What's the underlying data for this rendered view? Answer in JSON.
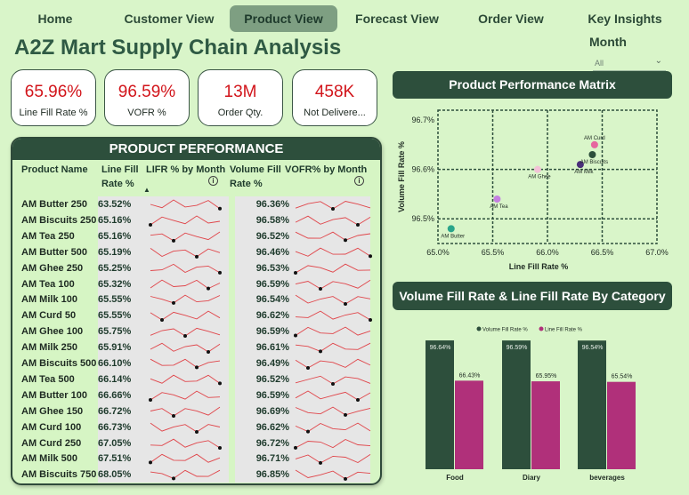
{
  "nav": {
    "tabs": [
      {
        "label": "Home"
      },
      {
        "label": "Customer View"
      },
      {
        "label": "Product View",
        "active": true
      },
      {
        "label": "Forecast View"
      },
      {
        "label": "Order View"
      },
      {
        "label": "Key Insights"
      }
    ]
  },
  "title": "A2Z Mart Supply Chain Analysis",
  "filter": {
    "label": "Month",
    "value": "All"
  },
  "kpis": [
    {
      "value": "65.96%",
      "label": "Line Fill Rate %"
    },
    {
      "value": "96.59%",
      "label": "VOFR %"
    },
    {
      "value": "13M",
      "label": "Order Qty."
    },
    {
      "value": "458K",
      "label": "Not Delivere..."
    }
  ],
  "product_table": {
    "title": "PRODUCT PERFORMANCE",
    "columns": {
      "name": "Product Name",
      "lifr": "Line Fill Rate %",
      "lifr_trend": "LIFR % by Month",
      "vofr": "Volume Fill Rate %",
      "vofr_trend": "VOFR% by Month"
    },
    "rows": [
      {
        "name": "AM Butter 250",
        "lifr": "63.52%",
        "vofr": "96.36%"
      },
      {
        "name": "AM Biscuits 250",
        "lifr": "65.16%",
        "vofr": "96.58%"
      },
      {
        "name": "AM Tea 250",
        "lifr": "65.16%",
        "vofr": "96.52%"
      },
      {
        "name": "AM Butter 500",
        "lifr": "65.19%",
        "vofr": "96.46%"
      },
      {
        "name": "AM Ghee 250",
        "lifr": "65.25%",
        "vofr": "96.53%"
      },
      {
        "name": "AM Tea 100",
        "lifr": "65.32%",
        "vofr": "96.59%"
      },
      {
        "name": "AM Milk 100",
        "lifr": "65.55%",
        "vofr": "96.54%"
      },
      {
        "name": "AM Curd 50",
        "lifr": "65.55%",
        "vofr": "96.62%"
      },
      {
        "name": "AM Ghee 100",
        "lifr": "65.75%",
        "vofr": "96.59%"
      },
      {
        "name": "AM Milk 250",
        "lifr": "65.91%",
        "vofr": "96.61%"
      },
      {
        "name": "AM Biscuits 500",
        "lifr": "66.10%",
        "vofr": "96.49%"
      },
      {
        "name": "AM Tea 500",
        "lifr": "66.14%",
        "vofr": "96.52%"
      },
      {
        "name": "AM Butter 100",
        "lifr": "66.66%",
        "vofr": "96.59%"
      },
      {
        "name": "AM Ghee 150",
        "lifr": "66.72%",
        "vofr": "96.69%"
      },
      {
        "name": "AM Curd 100",
        "lifr": "66.73%",
        "vofr": "96.62%"
      },
      {
        "name": "AM Curd 250",
        "lifr": "67.05%",
        "vofr": "96.72%"
      },
      {
        "name": "AM Milk 500",
        "lifr": "67.51%",
        "vofr": "96.71%"
      },
      {
        "name": "AM Biscuits 750",
        "lifr": "68.05%",
        "vofr": "96.85%"
      }
    ]
  },
  "colors": {
    "accent_dark": "#2d4f3c",
    "kpi_red": "#d2151b",
    "sparkline_red": "#e0454a",
    "bar_vofr": "#2d4f3c",
    "bar_lifr": "#b0307a"
  },
  "chart_data": [
    {
      "type": "scatter",
      "title": "Product Performance Matrix",
      "xlabel": "Line Fill Rate %",
      "ylabel": "Volume Fill Rate %",
      "xlim": [
        65.0,
        67.0
      ],
      "ylim": [
        96.45,
        96.72
      ],
      "xticks": [
        "65.0%",
        "65.5%",
        "66.0%",
        "66.5%",
        "67.0%"
      ],
      "yticks": [
        "96.7%",
        "96.6%",
        "96.5%"
      ],
      "grid": true,
      "points": [
        {
          "label": "AM Butter",
          "x": 65.12,
          "y": 96.48,
          "color": "#2aa58a"
        },
        {
          "label": "AM Tea",
          "x": 65.54,
          "y": 96.54,
          "color": "#c47fe0"
        },
        {
          "label": "AM Ghee",
          "x": 65.91,
          "y": 96.6,
          "color": "#f2c2d6"
        },
        {
          "label": "AM Milk",
          "x": 66.3,
          "y": 96.61,
          "color": "#4a2f7a"
        },
        {
          "label": "AM Biscuits",
          "x": 66.41,
          "y": 96.63,
          "color": "#2d4f3c"
        },
        {
          "label": "AM Curd",
          "x": 66.43,
          "y": 96.65,
          "color": "#e6679f"
        }
      ]
    },
    {
      "type": "bar",
      "title": "Volume Fill Rate & Line Fill Rate By Category",
      "categories": [
        "Food",
        "Diary",
        "beverages"
      ],
      "ylim": [
        0,
        100
      ],
      "legend": "top",
      "series": [
        {
          "name": "Volume Fill Rate %",
          "values": [
            96.64,
            96.59,
            96.54
          ],
          "labels": [
            "96.64%",
            "96.59%",
            "96.54%"
          ],
          "color": "#2d4f3c"
        },
        {
          "name": "Line Fill Rate %",
          "values": [
            66.43,
            65.95,
            65.54
          ],
          "labels": [
            "66.43%",
            "65.95%",
            "65.54%"
          ],
          "color": "#b0307a"
        }
      ]
    }
  ]
}
